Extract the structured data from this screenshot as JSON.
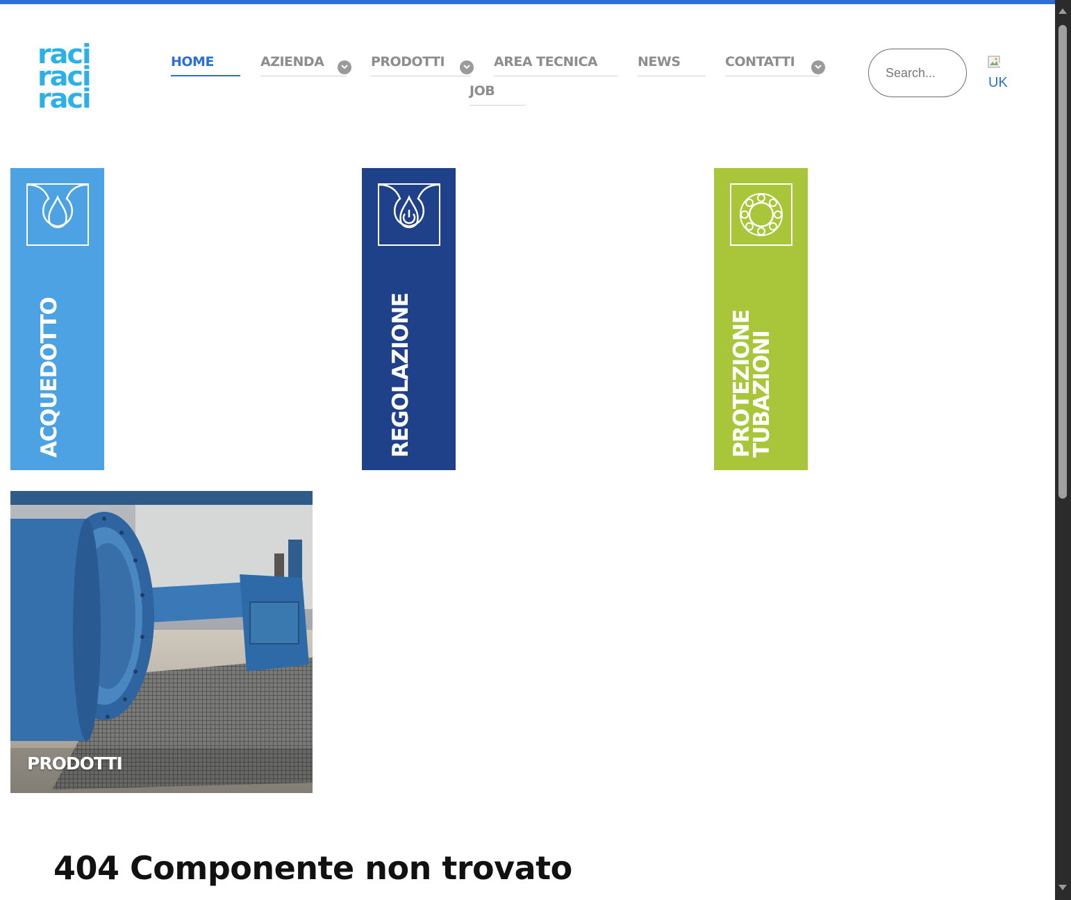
{
  "logo": {
    "lines": [
      "raci",
      "raci",
      "raci"
    ]
  },
  "nav": {
    "home": "HOME",
    "azienda": "AZIENDA",
    "prodotti": "PRODOTTI",
    "area_tecnica": "AREA TECNICA",
    "news": "NEWS",
    "contatti": "CONTATTI",
    "job": "JOB"
  },
  "search": {
    "placeholder": "Search..."
  },
  "language": {
    "label": "UK"
  },
  "categories": [
    {
      "label": "ACQUEDOTTO",
      "color": "#4ca2e3",
      "icon": "water-drop-icon"
    },
    {
      "label": "REGOLAZIONE",
      "color": "#1f4189",
      "icon": "power-drop-icon"
    },
    {
      "label_line1": "PROTEZIONE",
      "label_line2": "TUBAZIONI",
      "color": "#a9c63a",
      "icon": "flower-ring-icon"
    }
  ],
  "product_tile": {
    "label": "PRODOTTI"
  },
  "error": {
    "title": "404 Componente non trovato"
  },
  "colors": {
    "accent": "#2a6fd6",
    "nav_text": "#8d8d8d"
  }
}
